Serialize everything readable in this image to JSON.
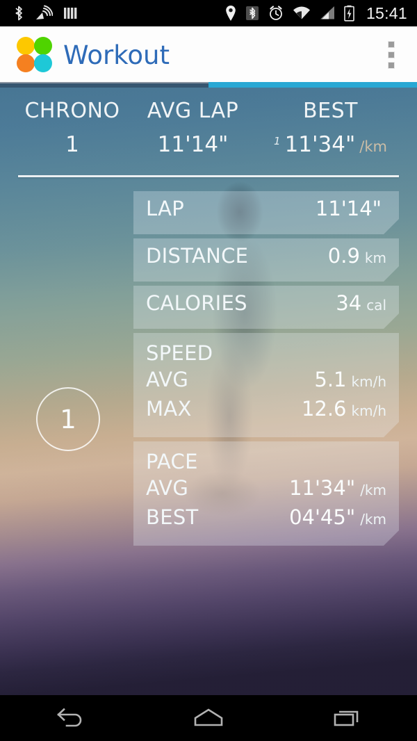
{
  "status_bar": {
    "left_icons": [
      "bluetooth-icon",
      "gps-satellite-icon",
      "vibrate-bars-icon"
    ],
    "right_icons": [
      "location-pin-icon",
      "bluetooth-connected-icon",
      "alarm-clock-icon",
      "wifi-icon",
      "cellular-signal-icon",
      "battery-charging-icon"
    ],
    "clock": "15:41"
  },
  "app_bar": {
    "title": "Workout",
    "title_color": "#2e6bb8",
    "logo_colors": {
      "top_left": "#fdc800",
      "top_right": "#4fd400",
      "bottom_left": "#f58020",
      "bottom_right": "#1ec8d7"
    },
    "overflow_menu": "overflow-menu"
  },
  "tabs": {
    "indicator_color": "#29a8d4",
    "selected_index": 1
  },
  "header_stats": [
    {
      "label": "CHRONO",
      "value": "1"
    },
    {
      "label": "AVG LAP",
      "value": "11'14\""
    }
  ],
  "header_best": {
    "label": "BEST",
    "superscript": "1",
    "value": "11'34\"",
    "unit": "/km"
  },
  "lap_badge": {
    "number": "1"
  },
  "cards": [
    {
      "title": null,
      "rows": [
        {
          "key": "LAP",
          "value": "11'14\"",
          "unit": ""
        }
      ]
    },
    {
      "title": null,
      "rows": [
        {
          "key": "DISTANCE",
          "value": "0.9",
          "unit": "km"
        }
      ]
    },
    {
      "title": null,
      "rows": [
        {
          "key": "CALORIES",
          "value": "34",
          "unit": "cal"
        }
      ]
    },
    {
      "title": "SPEED",
      "rows": [
        {
          "key": "AVG",
          "value": "5.1",
          "unit": "km/h"
        },
        {
          "key": "MAX",
          "value": "12.6",
          "unit": "km/h"
        }
      ]
    },
    {
      "title": "PACE",
      "rows": [
        {
          "key": "AVG",
          "value": "11'34\"",
          "unit": "/km"
        },
        {
          "key": "BEST",
          "value": "04'45\"",
          "unit": "/km"
        }
      ]
    }
  ],
  "nav_bar": {
    "back": "back-button",
    "home": "home-button",
    "recents": "recents-button"
  }
}
